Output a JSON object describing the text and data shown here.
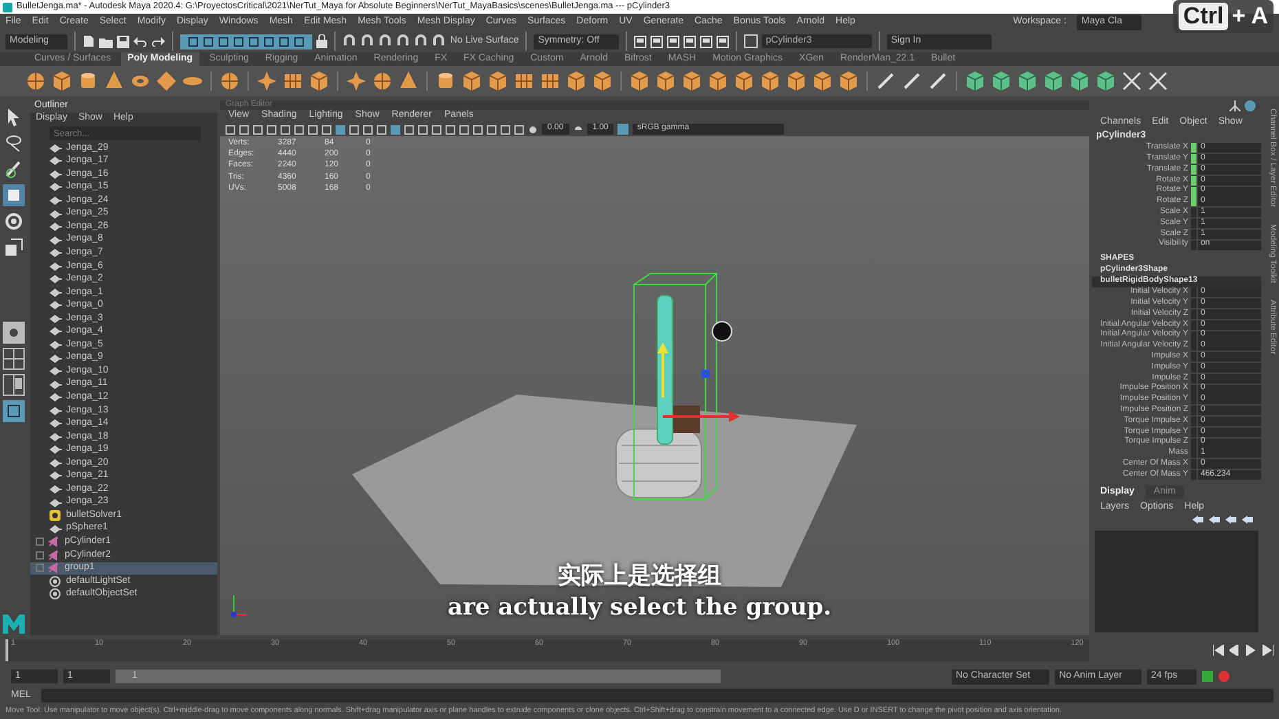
{
  "window": {
    "title": "BulletJenga.ma* - Autodesk Maya 2020.4: G:\\ProyectosCritical\\2021\\NerTut_Maya for Absolute Beginners\\NerTut_MayaBasics\\scenes\\BulletJenga.ma  ---  pCylinder3"
  },
  "menu_bar": {
    "items": [
      "File",
      "Edit",
      "Create",
      "Select",
      "Modify",
      "Display",
      "Windows",
      "Mesh",
      "Edit Mesh",
      "Mesh Tools",
      "Mesh Display",
      "Curves",
      "Surfaces",
      "Deform",
      "UV",
      "Generate",
      "Cache",
      "Bonus Tools",
      "Arnold",
      "Help"
    ],
    "workspace_label": "Workspace :",
    "workspace_value": "Maya Cla"
  },
  "status_line": {
    "menu_set": "Modeling",
    "live_surface": "No Live Surface",
    "symmetry": "Symmetry: Off",
    "object_field": "pCylinder3",
    "sign_in": "Sign In"
  },
  "shelf": {
    "tabs": [
      {
        "label": "Curves / Surfaces",
        "selected": false
      },
      {
        "label": "Poly Modeling",
        "selected": true
      },
      {
        "label": "Sculpting",
        "selected": false
      },
      {
        "label": "Rigging",
        "selected": false
      },
      {
        "label": "Animation",
        "selected": false
      },
      {
        "label": "Rendering",
        "selected": false
      },
      {
        "label": "FX",
        "selected": false
      },
      {
        "label": "FX Caching",
        "selected": false
      },
      {
        "label": "Custom",
        "selected": false
      },
      {
        "label": "Arnold",
        "selected": false
      },
      {
        "label": "Bifrost",
        "selected": false
      },
      {
        "label": "MASH",
        "selected": false
      },
      {
        "label": "Motion Graphics",
        "selected": false
      },
      {
        "label": "XGen",
        "selected": false
      },
      {
        "label": "RenderMan_22.1",
        "selected": false
      },
      {
        "label": "Bullet",
        "selected": false
      }
    ]
  },
  "toolbox": {
    "tools": [
      {
        "kind": "select",
        "selected": false
      },
      {
        "kind": "lasso",
        "selected": false
      },
      {
        "kind": "paint",
        "selected": false
      },
      {
        "kind": "move",
        "selected": true
      },
      {
        "kind": "rotate",
        "selected": false
      },
      {
        "kind": "scale",
        "selected": false
      }
    ]
  },
  "outliner": {
    "title": "Outliner",
    "menu": [
      "Display",
      "Show",
      "Help"
    ],
    "search_placeholder": "Search...",
    "items": [
      {
        "label": "Jenga_29",
        "kind": "mesh",
        "selected": false
      },
      {
        "label": "Jenga_17",
        "kind": "mesh",
        "selected": false
      },
      {
        "label": "Jenga_16",
        "kind": "mesh",
        "selected": false
      },
      {
        "label": "Jenga_15",
        "kind": "mesh",
        "selected": false
      },
      {
        "label": "Jenga_24",
        "kind": "mesh",
        "selected": false
      },
      {
        "label": "Jenga_25",
        "kind": "mesh",
        "selected": false
      },
      {
        "label": "Jenga_26",
        "kind": "mesh",
        "selected": false
      },
      {
        "label": "Jenga_8",
        "kind": "mesh",
        "selected": false
      },
      {
        "label": "Jenga_7",
        "kind": "mesh",
        "selected": false
      },
      {
        "label": "Jenga_6",
        "kind": "mesh",
        "selected": false
      },
      {
        "label": "Jenga_2",
        "kind": "mesh",
        "selected": false
      },
      {
        "label": "Jenga_1",
        "kind": "mesh",
        "selected": false
      },
      {
        "label": "Jenga_0",
        "kind": "mesh",
        "selected": false
      },
      {
        "label": "Jenga_3",
        "kind": "mesh",
        "selected": false
      },
      {
        "label": "Jenga_4",
        "kind": "mesh",
        "selected": false
      },
      {
        "label": "Jenga_5",
        "kind": "mesh",
        "selected": false
      },
      {
        "label": "Jenga_9",
        "kind": "mesh",
        "selected": false
      },
      {
        "label": "Jenga_10",
        "kind": "mesh",
        "selected": false
      },
      {
        "label": "Jenga_11",
        "kind": "mesh",
        "selected": false
      },
      {
        "label": "Jenga_12",
        "kind": "mesh",
        "selected": false
      },
      {
        "label": "Jenga_13",
        "kind": "mesh",
        "selected": false
      },
      {
        "label": "Jenga_14",
        "kind": "mesh",
        "selected": false
      },
      {
        "label": "Jenga_18",
        "kind": "mesh",
        "selected": false
      },
      {
        "label": "Jenga_19",
        "kind": "mesh",
        "selected": false
      },
      {
        "label": "Jenga_20",
        "kind": "mesh",
        "selected": false
      },
      {
        "label": "Jenga_21",
        "kind": "mesh",
        "selected": false
      },
      {
        "label": "Jenga_22",
        "kind": "mesh",
        "selected": false
      },
      {
        "label": "Jenga_23",
        "kind": "mesh",
        "selected": false
      },
      {
        "label": "bulletSolver1",
        "kind": "solver",
        "selected": false
      },
      {
        "label": "pSphere1",
        "kind": "mesh",
        "selected": false
      },
      {
        "label": "pCylinder1",
        "kind": "transform",
        "selected": false
      },
      {
        "label": "pCylinder2",
        "kind": "transform",
        "selected": false
      },
      {
        "label": "group1",
        "kind": "transform",
        "selected": true
      },
      {
        "label": "defaultLightSet",
        "kind": "set",
        "selected": false
      },
      {
        "label": "defaultObjectSet",
        "kind": "set",
        "selected": false
      }
    ]
  },
  "viewport": {
    "panel_title": "Graph Editor",
    "menu": [
      "View",
      "Shading",
      "Lighting",
      "Show",
      "Renderer",
      "Panels"
    ],
    "exposure": "0.00",
    "gamma": "1.00",
    "color_space": "sRGB gamma",
    "hud": [
      {
        "label": "Verts:",
        "values": [
          "3287",
          "84",
          "0"
        ]
      },
      {
        "label": "Edges:",
        "values": [
          "4440",
          "200",
          "0"
        ]
      },
      {
        "label": "Faces:",
        "values": [
          "2240",
          "120",
          "0"
        ]
      },
      {
        "label": "Tris:",
        "values": [
          "4360",
          "160",
          "0"
        ]
      },
      {
        "label": "UVs:",
        "values": [
          "5008",
          "168",
          "0"
        ]
      }
    ]
  },
  "channel_box": {
    "menu": [
      "Channels",
      "Edit",
      "Object",
      "Show"
    ],
    "object": "pCylinder3",
    "channels": [
      {
        "name": "Translate X",
        "value": "0",
        "keyed": true
      },
      {
        "name": "Translate Y",
        "value": "0",
        "keyed": true
      },
      {
        "name": "Translate Z",
        "value": "0",
        "keyed": true
      },
      {
        "name": "Rotate X",
        "value": "0",
        "keyed": true
      },
      {
        "name": "Rotate Y",
        "value": "0",
        "keyed": true
      },
      {
        "name": "Rotate Z",
        "value": "0",
        "keyed": true
      },
      {
        "name": "Scale X",
        "value": "1",
        "keyed": false
      },
      {
        "name": "Scale Y",
        "value": "1",
        "keyed": false
      },
      {
        "name": "Scale Z",
        "value": "1",
        "keyed": false
      },
      {
        "name": "Visibility",
        "value": "on",
        "keyed": false
      }
    ],
    "shapes_heading": "SHAPES",
    "shapes": [
      {
        "name": "pCylinder3Shape",
        "selected": false
      },
      {
        "name": "bulletRigidBodyShape13",
        "selected": true
      }
    ],
    "shape_channels": [
      {
        "name": "Initial Velocity X",
        "value": "0"
      },
      {
        "name": "Initial Velocity Y",
        "value": "0"
      },
      {
        "name": "Initial Velocity Z",
        "value": "0"
      },
      {
        "name": "Initial Angular Velocity X",
        "value": "0"
      },
      {
        "name": "Initial Angular Velocity Y",
        "value": "0"
      },
      {
        "name": "Initial Angular Velocity Z",
        "value": "0"
      },
      {
        "name": "Impulse X",
        "value": "0"
      },
      {
        "name": "Impulse Y",
        "value": "0"
      },
      {
        "name": "Impulse Z",
        "value": "0"
      },
      {
        "name": "Impulse Position X",
        "value": "0"
      },
      {
        "name": "Impulse Position Y",
        "value": "0"
      },
      {
        "name": "Impulse Position Z",
        "value": "0"
      },
      {
        "name": "Torque Impulse X",
        "value": "0"
      },
      {
        "name": "Torque Impulse Y",
        "value": "0"
      },
      {
        "name": "Torque Impulse Z",
        "value": "0"
      },
      {
        "name": "Mass",
        "value": "1"
      },
      {
        "name": "Center Of Mass X",
        "value": "0"
      },
      {
        "name": "Center Of Mass Y",
        "value": "466.234"
      }
    ]
  },
  "layer_editor": {
    "tabs": [
      {
        "label": "Display",
        "selected": true
      },
      {
        "label": "Anim",
        "selected": false
      }
    ],
    "menu": [
      "Layers",
      "Options",
      "Help"
    ]
  },
  "side_tabs": [
    "Channel Box / Layer Editor",
    "Modeling Toolkit",
    "Attribute Editor"
  ],
  "time_slider": {
    "level": 0,
    "ticks": [
      "1",
      "10",
      "20",
      "30",
      "40",
      "50",
      "60",
      "70",
      "80",
      "90",
      "100",
      "110",
      "120"
    ]
  },
  "range_slider": {
    "start": "1",
    "playback_start": "1",
    "range_label": "1",
    "level": 1,
    "character_set": "No Character Set",
    "anim_layer": "No Anim Layer",
    "fps": "24 fps"
  },
  "command_line": {
    "label": "MEL"
  },
  "help_line": "Move Tool: Use manipulator to move object(s). Ctrl+middle-drag to move components along normals. Shift+drag manipulator axis or plane handles to extrude components or clone objects. Ctrl+Shift+drag to constrain movement to a connected edge. Use D or INSERT to change the pivot position and axis orientation.",
  "subtitles": [
    "实际上是选择组",
    "are actually select the group."
  ],
  "key_overlay": [
    "Ctrl",
    "+ A"
  ]
}
